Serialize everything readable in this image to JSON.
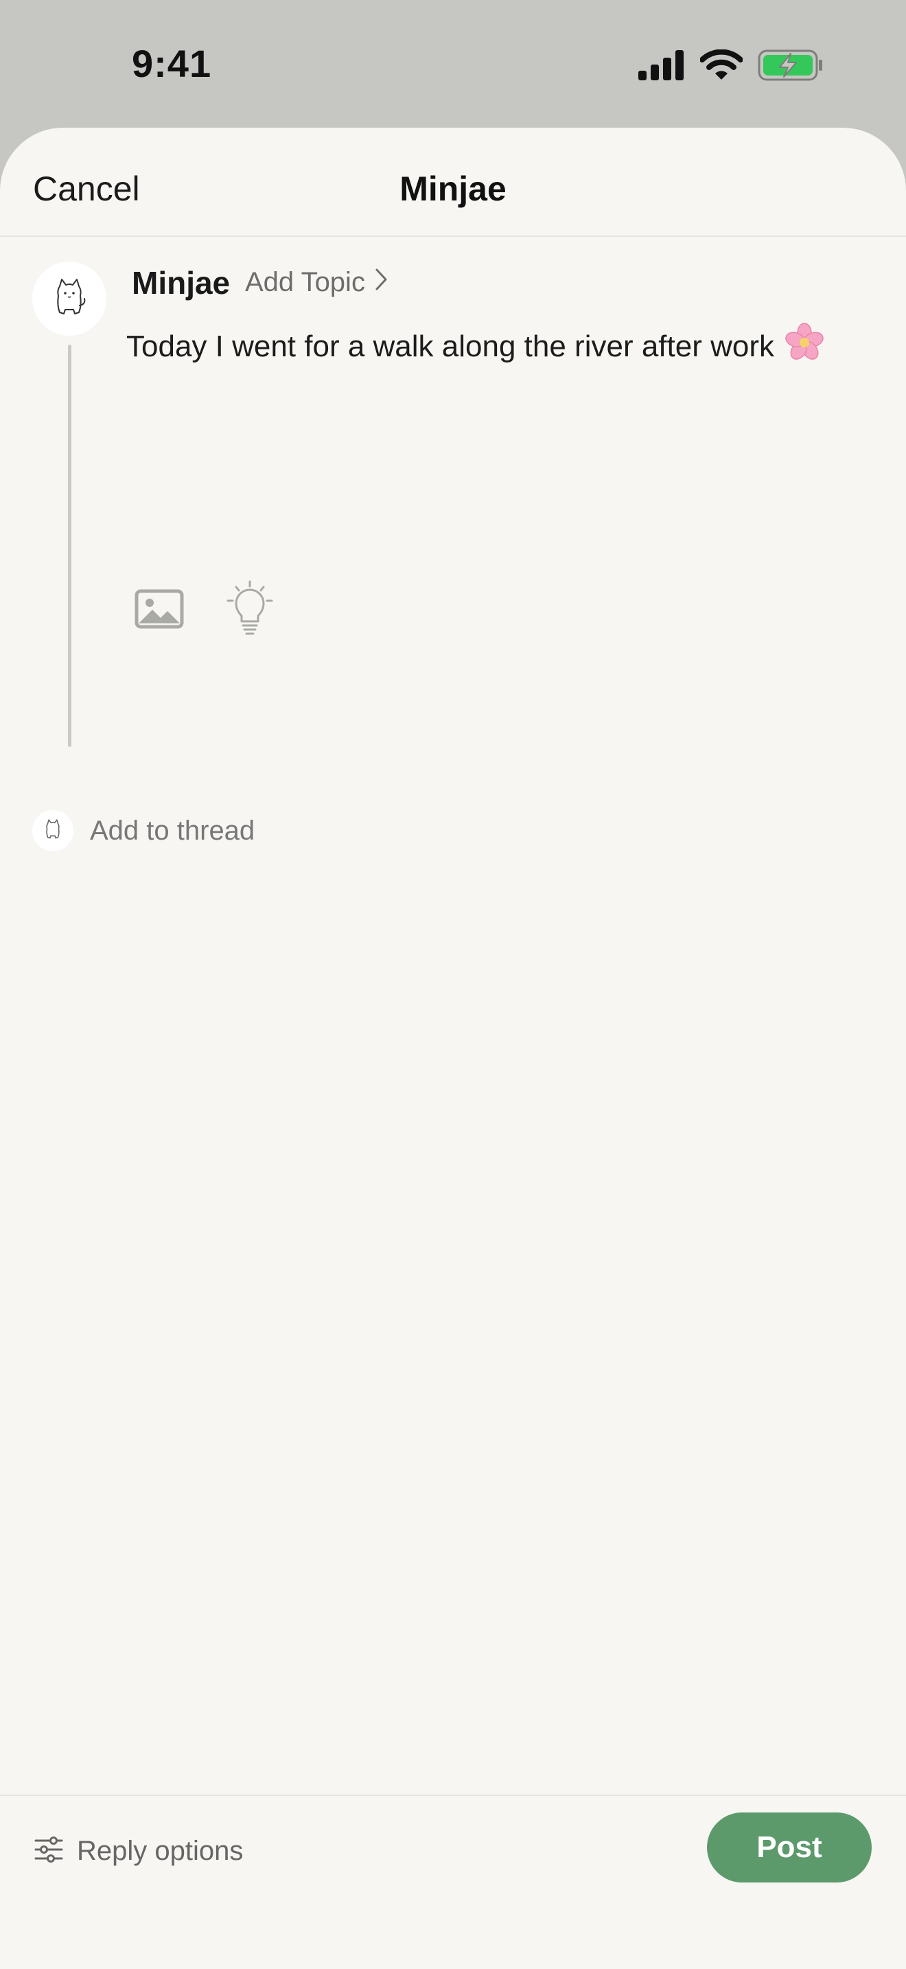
{
  "status_bar": {
    "time": "9:41",
    "icons": [
      "cellular-signal-icon",
      "wifi-icon",
      "battery-charging-icon"
    ],
    "battery_color": "#34c759"
  },
  "header": {
    "cancel_label": "Cancel",
    "title": "Minjae"
  },
  "compose": {
    "avatar_icon": "cat-avatar-icon",
    "username": "Minjae",
    "add_topic_label": "Add Topic",
    "post_text": "Today I went for a walk along the river after work",
    "post_emoji": "🌸",
    "attachments": [
      "image-icon",
      "lightbulb-icon"
    ]
  },
  "thread": {
    "add_label": "Add to thread"
  },
  "footer": {
    "reply_options_label": "Reply options",
    "post_label": "Post",
    "post_button_color": "#5c9a6c"
  }
}
